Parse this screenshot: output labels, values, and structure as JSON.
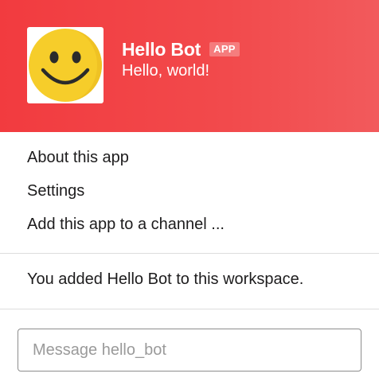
{
  "header": {
    "avatar_icon": "smiley-face-icon",
    "bot_name": "Hello Bot",
    "badge": "APP",
    "status": "Hello, world!",
    "accent_color": "#f23b3f"
  },
  "menu": {
    "items": [
      {
        "label": "About this app"
      },
      {
        "label": "Settings"
      },
      {
        "label": "Add this app to a channel ..."
      }
    ]
  },
  "workspace_note": "You added Hello Bot to this workspace.",
  "composer": {
    "value": "",
    "placeholder": "Message hello_bot"
  }
}
